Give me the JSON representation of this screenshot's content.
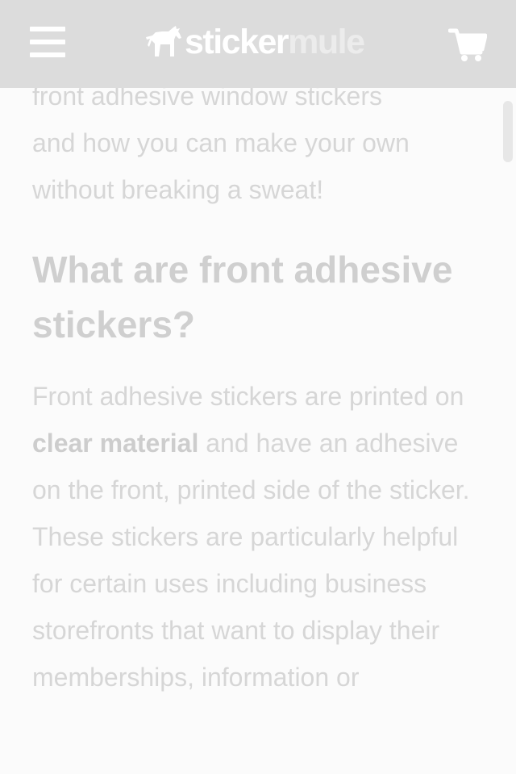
{
  "header": {
    "menu_icon": "hamburger-menu-icon",
    "logo_part1": "sticker",
    "logo_part2": "mule",
    "cart_icon": "shopping-cart-icon"
  },
  "article": {
    "intro_lines": [
      "front adhesive window stickers",
      "and how you can make your own",
      "without breaking a sweat!"
    ],
    "heading": "What are front adhesive stickers?",
    "body_before_bold": "Front adhesive stickers are printed on ",
    "body_bold": "clear material",
    "body_after_bold": " and have an adhesive on the front, printed side of the sticker. These stickers are particularly helpful for certain uses including business storefronts that want to display their memberships, information or"
  },
  "colors": {
    "header_bg": "#dcdcdc",
    "text_faded": "#d6d6d6"
  }
}
